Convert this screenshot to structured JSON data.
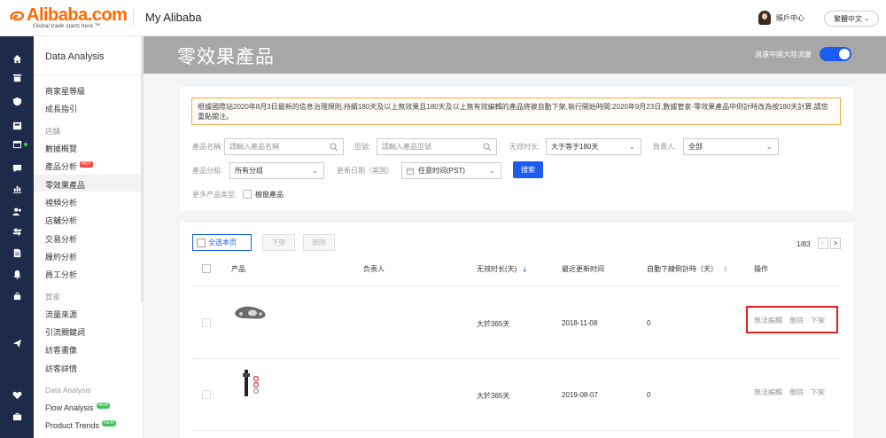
{
  "header": {
    "logo_text": "Alibaba.com",
    "logo_tagline": "Global trade starts here.™",
    "app_title": "My Alibaba",
    "user_center": "賬戶中心",
    "language": "繁體中文"
  },
  "sidebar": {
    "title": "Data Analysis",
    "items": [
      {
        "label": "商家星等級"
      },
      {
        "label": "成長指引"
      },
      {
        "label": "店舖",
        "group": true
      },
      {
        "label": "數據概覽"
      },
      {
        "label": "產品分析",
        "badge": "HOT"
      },
      {
        "label": "零效果產品",
        "active": true
      },
      {
        "label": "視頻分析"
      },
      {
        "label": "店舖分析"
      },
      {
        "label": "交易分析"
      },
      {
        "label": "履約分析"
      },
      {
        "label": "員工分析"
      },
      {
        "label": "買家",
        "group": true
      },
      {
        "label": "流量來源"
      },
      {
        "label": "引流關鍵詞"
      },
      {
        "label": "訪客畫像"
      },
      {
        "label": "訪客詳情"
      },
      {
        "label": "Data Analysis",
        "group": true
      },
      {
        "label": "Flow Analysis",
        "badge": "NEW"
      },
      {
        "label": "Product Trends",
        "badge": "NEW"
      }
    ]
  },
  "page": {
    "title": "零效果產品",
    "toggle_label": "過濾中國大陸流量",
    "toggle_on": true
  },
  "notice": "根據國際站2020年8月3日最新的信息治理規則,持續180天及以上無效果且180天及以上無有效編輯的產品將被自動下架,執行開始時間:2020年9月23日,數據管家-零效果產品中倒計時改為按180天計算,請您重點關注。",
  "filters": {
    "product_name_label": "產品名稱:",
    "product_name_placeholder": "請輸入產品名稱",
    "model_label": "型號:",
    "model_placeholder": "請輸入產品型號",
    "invalid_duration_label": "无效时长:",
    "invalid_duration_value": "大于等于180天",
    "owner_label": "負責人:",
    "owner_value": "全部",
    "group_label": "產品分組:",
    "group_value": "所有分组",
    "update_date_label": "更新日期（美国）",
    "update_date_value": "任意时间(PST)",
    "search_button": "搜索",
    "more_types_label": "更多产品类型:",
    "window_product_label": "櫥窗產品"
  },
  "table": {
    "select_all_label": "全选本页",
    "delist_label": "下架",
    "delete_label": "刪除",
    "pager": "1/83",
    "pager_prev": "<",
    "pager_next": ">",
    "columns": [
      "产品",
      "负责人",
      "无效时长(天)",
      "最近更新时间",
      "自動下線倒計時（天）",
      "操作"
    ],
    "rows": [
      {
        "duration": "大於365天",
        "updated": "2018-11-08",
        "countdown": "0",
        "actions": [
          "無法編輯",
          "刪除",
          "下架"
        ]
      },
      {
        "duration": "大於365天",
        "updated": "2019-08-07",
        "countdown": "0",
        "actions": [
          "無法編輯",
          "刪除",
          "下架"
        ]
      }
    ]
  },
  "colors": {
    "accent": "#1c5cf0",
    "brand": "#ff6a00",
    "sidebar_dark": "#1d2a4a",
    "banner": "#a7a7a7",
    "highlight_box": "#e0231a"
  }
}
